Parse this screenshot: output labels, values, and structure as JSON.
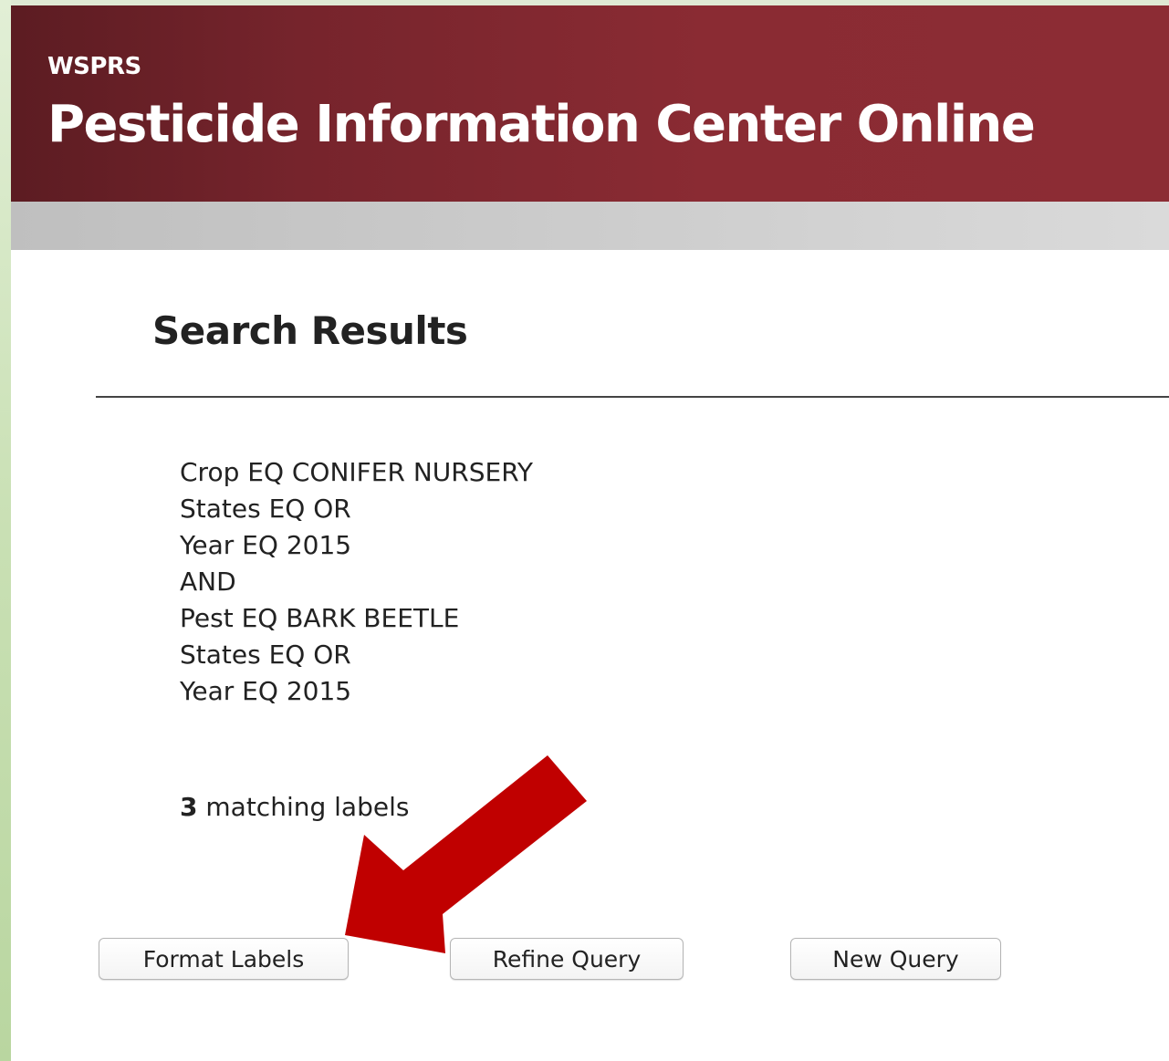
{
  "header": {
    "subtitle": "WSPRS",
    "title": "Pesticide Information Center Online"
  },
  "results": {
    "title": "Search Results",
    "query_lines": [
      "Crop EQ CONIFER NURSERY",
      "States EQ OR",
      "Year EQ 2015",
      "AND",
      "Pest EQ BARK BEETLE",
      "States EQ OR",
      "Year EQ 2015"
    ],
    "match_count": "3",
    "match_suffix": " matching labels"
  },
  "buttons": {
    "format_labels": "Format Labels",
    "refine_query": "Refine Query",
    "new_query": "New Query"
  },
  "colors": {
    "header_dark": "#5c1c22",
    "header_light": "#8c2c34",
    "arrow": "#c00000"
  }
}
